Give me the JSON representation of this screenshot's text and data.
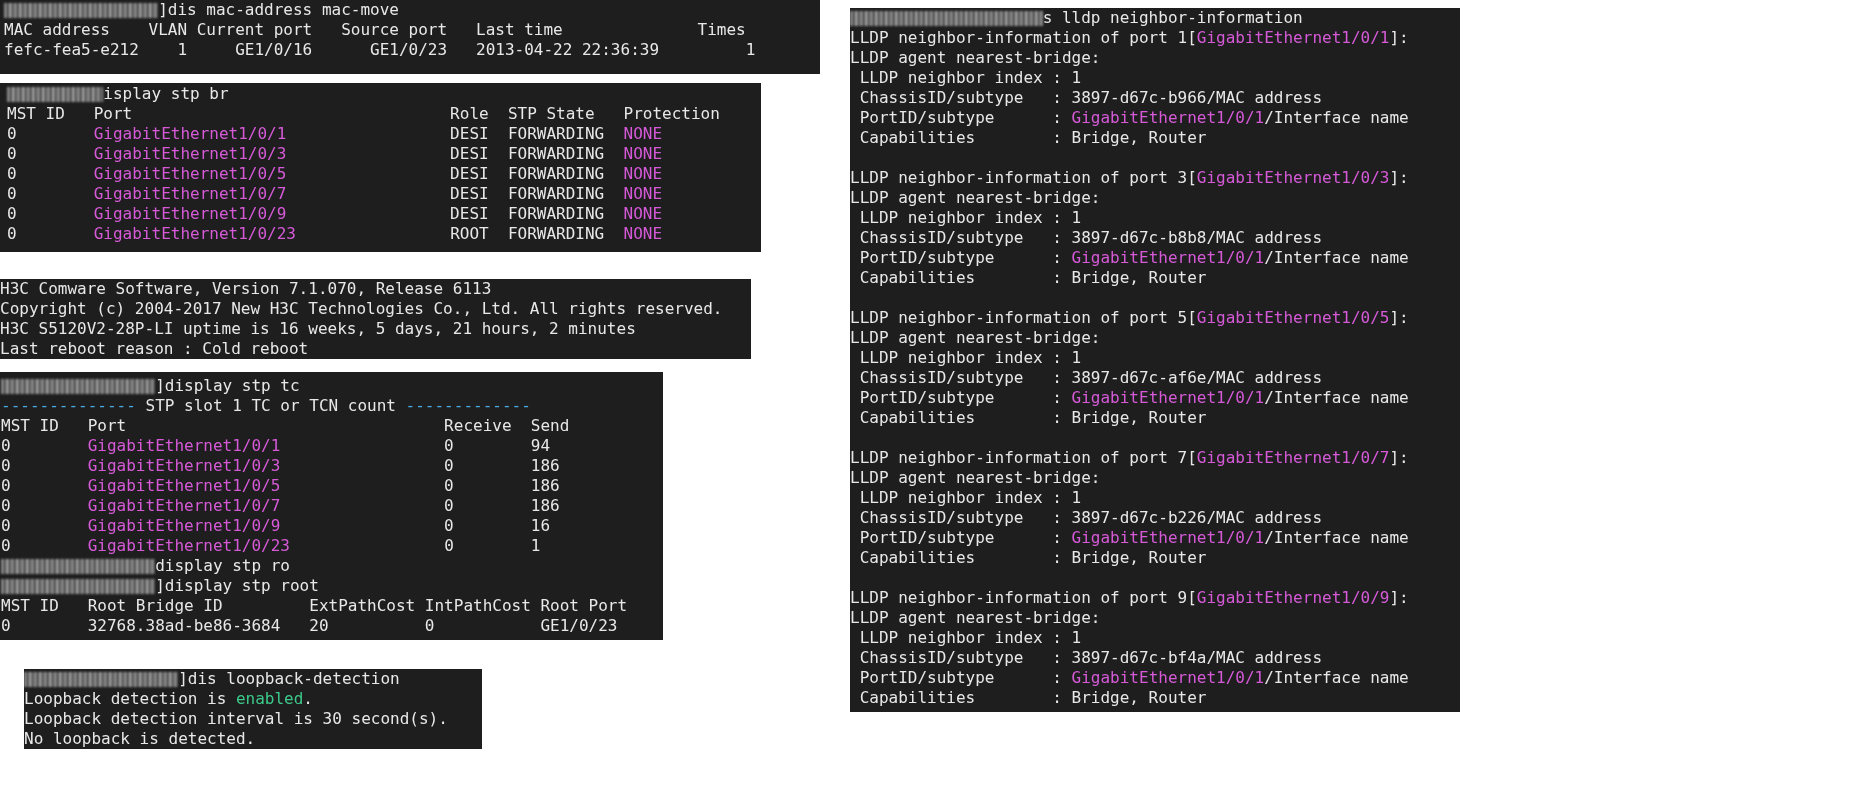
{
  "left_column": [
    {
      "blocks": [
        [
          {
            "kind": "prompt",
            "segments": [
              {
                "text": "]dis mac-address mac-move",
                "kind": "plain"
              }
            ]
          },
          {
            "kind": "output",
            "segments": [
              {
                "text": "MAC address    VLAN Current port   Source port   Last time              Times",
                "kind": "plain"
              }
            ]
          },
          {
            "kind": "output",
            "segments": [
              {
                "text": "fefc-fea5-e212    1     GE1/0/16      GE1/0/23   2013-04-22 22:36:39         1",
                "kind": "plain"
              }
            ]
          }
        ]
      ]
    },
    {
      "blocks": [
        [
          {
            "kind": "prompt",
            "segments": [
              {
                "text": "isplay stp br",
                "kind": "plain"
              }
            ]
          },
          {
            "kind": "output",
            "segments": [
              {
                "text": "MST ID   Port                                 Role  STP State   Protection",
                "kind": "plain"
              }
            ]
          },
          {
            "kind": "output",
            "segments": [
              {
                "text": "0        ",
                "kind": "plain"
              },
              {
                "text": "GigabitEthernet1/0/1",
                "kind": "highlight"
              },
              {
                "text": "                 DESI  FORWARDING  ",
                "kind": "plain"
              },
              {
                "text": "NONE",
                "kind": "highlight"
              }
            ]
          },
          {
            "kind": "output",
            "segments": [
              {
                "text": "0        ",
                "kind": "plain"
              },
              {
                "text": "GigabitEthernet1/0/3",
                "kind": "highlight"
              },
              {
                "text": "                 DESI  FORWARDING  ",
                "kind": "plain"
              },
              {
                "text": "NONE",
                "kind": "highlight"
              }
            ]
          },
          {
            "kind": "output",
            "segments": [
              {
                "text": "0        ",
                "kind": "plain"
              },
              {
                "text": "GigabitEthernet1/0/5",
                "kind": "highlight"
              },
              {
                "text": "                 DESI  FORWARDING  ",
                "kind": "plain"
              },
              {
                "text": "NONE",
                "kind": "highlight"
              }
            ]
          },
          {
            "kind": "output",
            "segments": [
              {
                "text": "0        ",
                "kind": "plain"
              },
              {
                "text": "GigabitEthernet1/0/7",
                "kind": "highlight"
              },
              {
                "text": "                 DESI  FORWARDING  ",
                "kind": "plain"
              },
              {
                "text": "NONE",
                "kind": "highlight"
              }
            ]
          },
          {
            "kind": "output",
            "segments": [
              {
                "text": "0        ",
                "kind": "plain"
              },
              {
                "text": "GigabitEthernet1/0/9",
                "kind": "highlight"
              },
              {
                "text": "                 DESI  FORWARDING  ",
                "kind": "plain"
              },
              {
                "text": "NONE",
                "kind": "highlight"
              }
            ]
          },
          {
            "kind": "output",
            "segments": [
              {
                "text": "0        ",
                "kind": "plain"
              },
              {
                "text": "GigabitEthernet1/0/23",
                "kind": "highlight"
              },
              {
                "text": "                ROOT  FORWARDING  ",
                "kind": "plain"
              },
              {
                "text": "NONE",
                "kind": "highlight"
              }
            ]
          }
        ]
      ]
    },
    {
      "blocks": [
        [
          {
            "kind": "output",
            "segments": [
              {
                "text": "H3C Comware Software, Version 7.1.070, Release 6113",
                "kind": "plain"
              }
            ]
          },
          {
            "kind": "output",
            "segments": [
              {
                "text": "Copyright (c) 2004-2017 New H3C Technologies Co., Ltd. All rights reserved.",
                "kind": "plain"
              }
            ]
          },
          {
            "kind": "output",
            "segments": [
              {
                "text": "H3C S5120V2-28P-LI uptime is 16 weeks, 5 days, 21 hours, 2 minutes",
                "kind": "plain"
              }
            ]
          },
          {
            "kind": "output",
            "segments": [
              {
                "text": "Last reboot reason : Cold reboot",
                "kind": "plain"
              }
            ]
          }
        ]
      ]
    },
    {
      "blocks": [
        [
          {
            "kind": "prompt",
            "segments": [
              {
                "text": "]display stp tc",
                "kind": "plain"
              }
            ]
          },
          {
            "kind": "output",
            "segments": [
              {
                "text": "--------------",
                "kind": "rule"
              },
              {
                "text": " STP slot 1 TC or TCN count ",
                "kind": "plain"
              },
              {
                "text": "-------------",
                "kind": "rule"
              }
            ]
          },
          {
            "kind": "output",
            "segments": [
              {
                "text": "MST ID   Port                                 Receive  Send",
                "kind": "plain"
              }
            ]
          },
          {
            "kind": "output",
            "segments": [
              {
                "text": "0        ",
                "kind": "plain"
              },
              {
                "text": "GigabitEthernet1/0/1",
                "kind": "highlight"
              },
              {
                "text": "                 0        94",
                "kind": "plain"
              }
            ]
          },
          {
            "kind": "output",
            "segments": [
              {
                "text": "0        ",
                "kind": "plain"
              },
              {
                "text": "GigabitEthernet1/0/3",
                "kind": "highlight"
              },
              {
                "text": "                 0        186",
                "kind": "plain"
              }
            ]
          },
          {
            "kind": "output",
            "segments": [
              {
                "text": "0        ",
                "kind": "plain"
              },
              {
                "text": "GigabitEthernet1/0/5",
                "kind": "highlight"
              },
              {
                "text": "                 0        186",
                "kind": "plain"
              }
            ]
          },
          {
            "kind": "output",
            "segments": [
              {
                "text": "0        ",
                "kind": "plain"
              },
              {
                "text": "GigabitEthernet1/0/7",
                "kind": "highlight"
              },
              {
                "text": "                 0        186",
                "kind": "plain"
              }
            ]
          },
          {
            "kind": "output",
            "segments": [
              {
                "text": "0        ",
                "kind": "plain"
              },
              {
                "text": "GigabitEthernet1/0/9",
                "kind": "highlight"
              },
              {
                "text": "                 0        16",
                "kind": "plain"
              }
            ]
          },
          {
            "kind": "output",
            "segments": [
              {
                "text": "0        ",
                "kind": "plain"
              },
              {
                "text": "GigabitEthernet1/0/23",
                "kind": "highlight"
              },
              {
                "text": "                0        1",
                "kind": "plain"
              }
            ]
          },
          {
            "kind": "prompt",
            "segments": [
              {
                "text": "display stp ro",
                "kind": "plain"
              }
            ]
          },
          {
            "kind": "prompt",
            "segments": [
              {
                "text": "]display stp root",
                "kind": "plain"
              }
            ]
          },
          {
            "kind": "output",
            "segments": [
              {
                "text": "MST ID   Root Bridge ID         ExtPathCost IntPathCost Root Port",
                "kind": "plain"
              }
            ]
          },
          {
            "kind": "output",
            "segments": [
              {
                "text": "0        32768.38ad-be86-3684   20          0           GE1/0/23",
                "kind": "plain"
              }
            ]
          }
        ]
      ]
    },
    {
      "blocks": [
        [
          {
            "kind": "prompt",
            "segments": [
              {
                "text": "]dis loopback-detection",
                "kind": "plain"
              }
            ]
          },
          {
            "kind": "output",
            "segments": [
              {
                "text": "Loopback detection is ",
                "kind": "plain"
              },
              {
                "text": "enabled",
                "kind": "success"
              },
              {
                "text": ".",
                "kind": "plain"
              }
            ]
          },
          {
            "kind": "output",
            "segments": [
              {
                "text": "Loopback detection interval is 30 second(s).",
                "kind": "plain"
              }
            ]
          },
          {
            "kind": "output",
            "segments": [
              {
                "text": "No loopback is detected.",
                "kind": "plain"
              }
            ]
          }
        ]
      ]
    }
  ],
  "right_column": [
    {
      "blocks": [
        [
          {
            "kind": "prompt",
            "segments": [
              {
                "text": "s lldp neighbor-information",
                "kind": "plain"
              }
            ]
          },
          {
            "kind": "output",
            "segments": [
              {
                "text": "LLDP neighbor-information of port 1[",
                "kind": "plain"
              },
              {
                "text": "GigabitEthernet1/0/1",
                "kind": "highlight"
              },
              {
                "text": "]:",
                "kind": "plain"
              }
            ]
          },
          {
            "kind": "output",
            "segments": [
              {
                "text": "LLDP agent nearest-bridge:",
                "kind": "plain"
              }
            ]
          },
          {
            "kind": "output",
            "segments": [
              {
                "text": " LLDP neighbor index : 1",
                "kind": "plain"
              }
            ]
          },
          {
            "kind": "output",
            "segments": [
              {
                "text": " ChassisID/subtype   : 3897-d67c-b966/MAC address",
                "kind": "plain"
              }
            ]
          },
          {
            "kind": "output",
            "segments": [
              {
                "text": " PortID/subtype      : ",
                "kind": "plain"
              },
              {
                "text": "GigabitEthernet1/0/1",
                "kind": "highlight"
              },
              {
                "text": "/Interface name",
                "kind": "plain"
              }
            ]
          },
          {
            "kind": "output",
            "segments": [
              {
                "text": " Capabilities        : Bridge, Router",
                "kind": "plain"
              }
            ]
          }
        ],
        [
          {
            "kind": "output",
            "segments": [
              {
                "text": "LLDP neighbor-information of port 3[",
                "kind": "plain"
              },
              {
                "text": "GigabitEthernet1/0/3",
                "kind": "highlight"
              },
              {
                "text": "]:",
                "kind": "plain"
              }
            ]
          },
          {
            "kind": "output",
            "segments": [
              {
                "text": "LLDP agent nearest-bridge:",
                "kind": "plain"
              }
            ]
          },
          {
            "kind": "output",
            "segments": [
              {
                "text": " LLDP neighbor index : 1",
                "kind": "plain"
              }
            ]
          },
          {
            "kind": "output",
            "segments": [
              {
                "text": " ChassisID/subtype   : 3897-d67c-b8b8/MAC address",
                "kind": "plain"
              }
            ]
          },
          {
            "kind": "output",
            "segments": [
              {
                "text": " PortID/subtype      : ",
                "kind": "plain"
              },
              {
                "text": "GigabitEthernet1/0/1",
                "kind": "highlight"
              },
              {
                "text": "/Interface name",
                "kind": "plain"
              }
            ]
          },
          {
            "kind": "output",
            "segments": [
              {
                "text": " Capabilities        : Bridge, Router",
                "kind": "plain"
              }
            ]
          }
        ],
        [
          {
            "kind": "output",
            "segments": [
              {
                "text": "LLDP neighbor-information of port 5[",
                "kind": "plain"
              },
              {
                "text": "GigabitEthernet1/0/5",
                "kind": "highlight"
              },
              {
                "text": "]:",
                "kind": "plain"
              }
            ]
          },
          {
            "kind": "output",
            "segments": [
              {
                "text": "LLDP agent nearest-bridge:",
                "kind": "plain"
              }
            ]
          },
          {
            "kind": "output",
            "segments": [
              {
                "text": " LLDP neighbor index : 1",
                "kind": "plain"
              }
            ]
          },
          {
            "kind": "output",
            "segments": [
              {
                "text": " ChassisID/subtype   : 3897-d67c-af6e/MAC address",
                "kind": "plain"
              }
            ]
          },
          {
            "kind": "output",
            "segments": [
              {
                "text": " PortID/subtype      : ",
                "kind": "plain"
              },
              {
                "text": "GigabitEthernet1/0/1",
                "kind": "highlight"
              },
              {
                "text": "/Interface name",
                "kind": "plain"
              }
            ]
          },
          {
            "kind": "output",
            "segments": [
              {
                "text": " Capabilities        : Bridge, Router",
                "kind": "plain"
              }
            ]
          }
        ],
        [
          {
            "kind": "output",
            "segments": [
              {
                "text": "LLDP neighbor-information of port 7[",
                "kind": "plain"
              },
              {
                "text": "GigabitEthernet1/0/7",
                "kind": "highlight"
              },
              {
                "text": "]:",
                "kind": "plain"
              }
            ]
          },
          {
            "kind": "output",
            "segments": [
              {
                "text": "LLDP agent nearest-bridge:",
                "kind": "plain"
              }
            ]
          },
          {
            "kind": "output",
            "segments": [
              {
                "text": " LLDP neighbor index : 1",
                "kind": "plain"
              }
            ]
          },
          {
            "kind": "output",
            "segments": [
              {
                "text": " ChassisID/subtype   : 3897-d67c-b226/MAC address",
                "kind": "plain"
              }
            ]
          },
          {
            "kind": "output",
            "segments": [
              {
                "text": " PortID/subtype      : ",
                "kind": "plain"
              },
              {
                "text": "GigabitEthernet1/0/1",
                "kind": "highlight"
              },
              {
                "text": "/Interface name",
                "kind": "plain"
              }
            ]
          },
          {
            "kind": "output",
            "segments": [
              {
                "text": " Capabilities        : Bridge, Router",
                "kind": "plain"
              }
            ]
          }
        ],
        [
          {
            "kind": "output",
            "segments": [
              {
                "text": "LLDP neighbor-information of port 9[",
                "kind": "plain"
              },
              {
                "text": "GigabitEthernet1/0/9",
                "kind": "highlight"
              },
              {
                "text": "]:",
                "kind": "plain"
              }
            ]
          },
          {
            "kind": "output",
            "segments": [
              {
                "text": "LLDP agent nearest-bridge:",
                "kind": "plain"
              }
            ]
          },
          {
            "kind": "output",
            "segments": [
              {
                "text": " LLDP neighbor index : 1",
                "kind": "plain"
              }
            ]
          },
          {
            "kind": "output",
            "segments": [
              {
                "text": " ChassisID/subtype   : 3897-d67c-bf4a/MAC address",
                "kind": "plain"
              }
            ]
          },
          {
            "kind": "output",
            "segments": [
              {
                "text": " PortID/subtype      : ",
                "kind": "plain"
              },
              {
                "text": "GigabitEthernet1/0/1",
                "kind": "highlight"
              },
              {
                "text": "/Interface name",
                "kind": "plain"
              }
            ]
          },
          {
            "kind": "output",
            "segments": [
              {
                "text": " Capabilities        : Bridge, Router",
                "kind": "plain"
              }
            ]
          }
        ]
      ]
    }
  ]
}
